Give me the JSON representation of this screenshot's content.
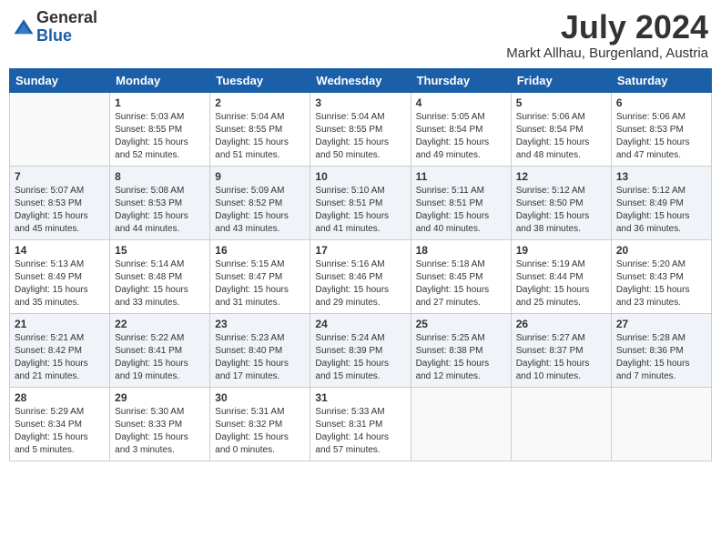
{
  "header": {
    "logo_general": "General",
    "logo_blue": "Blue",
    "month_year": "July 2024",
    "location": "Markt Allhau, Burgenland, Austria"
  },
  "days_of_week": [
    "Sunday",
    "Monday",
    "Tuesday",
    "Wednesday",
    "Thursday",
    "Friday",
    "Saturday"
  ],
  "weeks": [
    [
      {
        "day": "",
        "info": ""
      },
      {
        "day": "1",
        "info": "Sunrise: 5:03 AM\nSunset: 8:55 PM\nDaylight: 15 hours\nand 52 minutes."
      },
      {
        "day": "2",
        "info": "Sunrise: 5:04 AM\nSunset: 8:55 PM\nDaylight: 15 hours\nand 51 minutes."
      },
      {
        "day": "3",
        "info": "Sunrise: 5:04 AM\nSunset: 8:55 PM\nDaylight: 15 hours\nand 50 minutes."
      },
      {
        "day": "4",
        "info": "Sunrise: 5:05 AM\nSunset: 8:54 PM\nDaylight: 15 hours\nand 49 minutes."
      },
      {
        "day": "5",
        "info": "Sunrise: 5:06 AM\nSunset: 8:54 PM\nDaylight: 15 hours\nand 48 minutes."
      },
      {
        "day": "6",
        "info": "Sunrise: 5:06 AM\nSunset: 8:53 PM\nDaylight: 15 hours\nand 47 minutes."
      }
    ],
    [
      {
        "day": "7",
        "info": "Sunrise: 5:07 AM\nSunset: 8:53 PM\nDaylight: 15 hours\nand 45 minutes."
      },
      {
        "day": "8",
        "info": "Sunrise: 5:08 AM\nSunset: 8:53 PM\nDaylight: 15 hours\nand 44 minutes."
      },
      {
        "day": "9",
        "info": "Sunrise: 5:09 AM\nSunset: 8:52 PM\nDaylight: 15 hours\nand 43 minutes."
      },
      {
        "day": "10",
        "info": "Sunrise: 5:10 AM\nSunset: 8:51 PM\nDaylight: 15 hours\nand 41 minutes."
      },
      {
        "day": "11",
        "info": "Sunrise: 5:11 AM\nSunset: 8:51 PM\nDaylight: 15 hours\nand 40 minutes."
      },
      {
        "day": "12",
        "info": "Sunrise: 5:12 AM\nSunset: 8:50 PM\nDaylight: 15 hours\nand 38 minutes."
      },
      {
        "day": "13",
        "info": "Sunrise: 5:12 AM\nSunset: 8:49 PM\nDaylight: 15 hours\nand 36 minutes."
      }
    ],
    [
      {
        "day": "14",
        "info": "Sunrise: 5:13 AM\nSunset: 8:49 PM\nDaylight: 15 hours\nand 35 minutes."
      },
      {
        "day": "15",
        "info": "Sunrise: 5:14 AM\nSunset: 8:48 PM\nDaylight: 15 hours\nand 33 minutes."
      },
      {
        "day": "16",
        "info": "Sunrise: 5:15 AM\nSunset: 8:47 PM\nDaylight: 15 hours\nand 31 minutes."
      },
      {
        "day": "17",
        "info": "Sunrise: 5:16 AM\nSunset: 8:46 PM\nDaylight: 15 hours\nand 29 minutes."
      },
      {
        "day": "18",
        "info": "Sunrise: 5:18 AM\nSunset: 8:45 PM\nDaylight: 15 hours\nand 27 minutes."
      },
      {
        "day": "19",
        "info": "Sunrise: 5:19 AM\nSunset: 8:44 PM\nDaylight: 15 hours\nand 25 minutes."
      },
      {
        "day": "20",
        "info": "Sunrise: 5:20 AM\nSunset: 8:43 PM\nDaylight: 15 hours\nand 23 minutes."
      }
    ],
    [
      {
        "day": "21",
        "info": "Sunrise: 5:21 AM\nSunset: 8:42 PM\nDaylight: 15 hours\nand 21 minutes."
      },
      {
        "day": "22",
        "info": "Sunrise: 5:22 AM\nSunset: 8:41 PM\nDaylight: 15 hours\nand 19 minutes."
      },
      {
        "day": "23",
        "info": "Sunrise: 5:23 AM\nSunset: 8:40 PM\nDaylight: 15 hours\nand 17 minutes."
      },
      {
        "day": "24",
        "info": "Sunrise: 5:24 AM\nSunset: 8:39 PM\nDaylight: 15 hours\nand 15 minutes."
      },
      {
        "day": "25",
        "info": "Sunrise: 5:25 AM\nSunset: 8:38 PM\nDaylight: 15 hours\nand 12 minutes."
      },
      {
        "day": "26",
        "info": "Sunrise: 5:27 AM\nSunset: 8:37 PM\nDaylight: 15 hours\nand 10 minutes."
      },
      {
        "day": "27",
        "info": "Sunrise: 5:28 AM\nSunset: 8:36 PM\nDaylight: 15 hours\nand 7 minutes."
      }
    ],
    [
      {
        "day": "28",
        "info": "Sunrise: 5:29 AM\nSunset: 8:34 PM\nDaylight: 15 hours\nand 5 minutes."
      },
      {
        "day": "29",
        "info": "Sunrise: 5:30 AM\nSunset: 8:33 PM\nDaylight: 15 hours\nand 3 minutes."
      },
      {
        "day": "30",
        "info": "Sunrise: 5:31 AM\nSunset: 8:32 PM\nDaylight: 15 hours\nand 0 minutes."
      },
      {
        "day": "31",
        "info": "Sunrise: 5:33 AM\nSunset: 8:31 PM\nDaylight: 14 hours\nand 57 minutes."
      },
      {
        "day": "",
        "info": ""
      },
      {
        "day": "",
        "info": ""
      },
      {
        "day": "",
        "info": ""
      }
    ]
  ]
}
